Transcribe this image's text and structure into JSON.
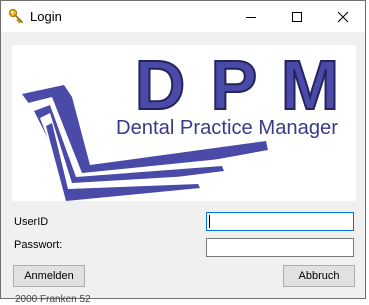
{
  "window": {
    "title": "Login",
    "title_icon": "key-icon",
    "controls": {
      "minimize_icon": "minimize-icon",
      "maximize_icon": "maximize-icon",
      "close_icon": "close-icon"
    }
  },
  "logo": {
    "letters": [
      "D",
      "P",
      "M"
    ],
    "subtitle": "Dental Practice Manager",
    "brand_color": "#4a4aa8"
  },
  "form": {
    "userid_label": "UserID",
    "userid_value": "",
    "password_label": "Passwort:",
    "password_value": ""
  },
  "buttons": {
    "login_label": "Anmelden",
    "cancel_label": "Abbruch"
  },
  "background": {
    "partial_text": "2000 Franken 52"
  },
  "colors": {
    "focus_border": "#0078d7",
    "button_bg": "#e1e1e1",
    "dialog_bg": "#f0f0f0"
  }
}
